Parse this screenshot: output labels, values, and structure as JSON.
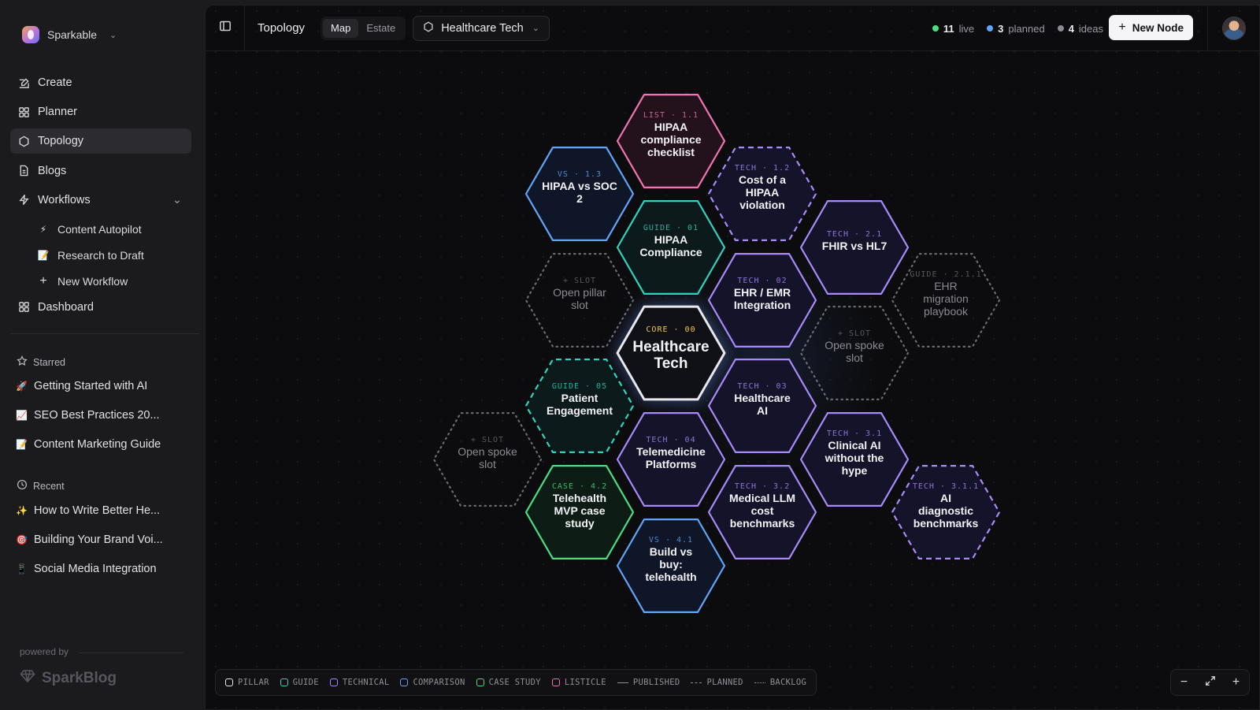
{
  "workspace": {
    "name": "Sparkable"
  },
  "nav": [
    {
      "label": "Create",
      "icon": "edit-icon"
    },
    {
      "label": "Planner",
      "icon": "grid-icon"
    },
    {
      "label": "Topology",
      "icon": "hexagon-icon",
      "active": true
    },
    {
      "label": "Blogs",
      "icon": "document-icon"
    },
    {
      "label": "Workflows",
      "icon": "lightning-icon"
    }
  ],
  "workflows": [
    {
      "label": "Content Autopilot",
      "icon": "⚡"
    },
    {
      "label": "Research to Draft",
      "icon": "📝"
    },
    {
      "label": "New Workflow",
      "icon": "+"
    }
  ],
  "dashboard": {
    "label": "Dashboard"
  },
  "starred": {
    "title": "Starred",
    "items": [
      {
        "label": "Getting Started with AI",
        "icon": "🚀"
      },
      {
        "label": "SEO Best Practices 20...",
        "icon": "📈"
      },
      {
        "label": "Content Marketing Guide",
        "icon": "📝"
      }
    ]
  },
  "recent": {
    "title": "Recent",
    "items": [
      {
        "label": "How to Write Better He...",
        "icon": "✨"
      },
      {
        "label": "Building Your Brand Voi...",
        "icon": "🎯"
      },
      {
        "label": "Social Media Integration",
        "icon": "📱"
      }
    ]
  },
  "footer": {
    "powered": "powered by",
    "brand": "SparkBlog"
  },
  "topbar": {
    "title": "Topology",
    "views": [
      "Map",
      "Estate"
    ],
    "active_view": "Map",
    "project": "Healthcare Tech"
  },
  "stats": [
    {
      "count": "11",
      "label": "live",
      "color": "#4ade80"
    },
    {
      "count": "3",
      "label": "planned",
      "color": "#60a5fa"
    },
    {
      "count": "4",
      "label": "ideas",
      "color": "#8a8a92"
    }
  ],
  "new_node_label": "New Node",
  "colors": {
    "pillar": "#e8e8ec",
    "guide": "#2dd4bf",
    "technical": "#a78bfa",
    "comparison": "#60a5fa",
    "case": "#4ade80",
    "listicle": "#f472b6",
    "slot": "#6a6a72"
  },
  "nodes": [
    {
      "tag": "LIST · 1.1",
      "title": [
        "HIPAA",
        "compliance",
        "checklist"
      ],
      "kind": "listicle",
      "status": "published"
    },
    {
      "tag": "VS · 1.3",
      "title": [
        "HIPAA vs SOC",
        "2"
      ],
      "kind": "comparison",
      "status": "published"
    },
    {
      "tag": "TECH · 1.2",
      "title": [
        "Cost of a",
        "HIPAA",
        "violation"
      ],
      "kind": "technical",
      "status": "planned"
    },
    {
      "tag": "GUIDE · 01",
      "title": [
        "HIPAA",
        "Compliance"
      ],
      "kind": "guide",
      "status": "published"
    },
    {
      "tag": "TECH · 2.1",
      "title": [
        "FHIR vs HL7"
      ],
      "kind": "technical",
      "status": "published"
    },
    {
      "tag": "+ SLOT",
      "title": [
        "Open pillar",
        "slot"
      ],
      "kind": "slot",
      "status": "backlog"
    },
    {
      "tag": "TECH · 02",
      "title": [
        "EHR / EMR",
        "Integration"
      ],
      "kind": "technical",
      "status": "published"
    },
    {
      "tag": "GUIDE · 2.1.1",
      "title": [
        "EHR",
        "migration",
        "playbook"
      ],
      "kind": "slot",
      "status": "backlog"
    },
    {
      "tag": "CORE · 00",
      "title": [
        "Healthcare",
        "Tech"
      ],
      "kind": "pillar",
      "status": "published"
    },
    {
      "tag": "+ SLOT",
      "title": [
        "Open spoke",
        "slot"
      ],
      "kind": "slot",
      "status": "backlog"
    },
    {
      "tag": "GUIDE · 05",
      "title": [
        "Patient",
        "Engagement"
      ],
      "kind": "guide",
      "status": "planned"
    },
    {
      "tag": "TECH · 03",
      "title": [
        "Healthcare",
        "AI"
      ],
      "kind": "technical",
      "status": "published"
    },
    {
      "tag": "+ SLOT",
      "title": [
        "Open spoke",
        "slot"
      ],
      "kind": "slot",
      "status": "backlog"
    },
    {
      "tag": "TECH · 04",
      "title": [
        "Telemedicine",
        "Platforms"
      ],
      "kind": "technical",
      "status": "published"
    },
    {
      "tag": "TECH · 3.1",
      "title": [
        "Clinical AI",
        "without the",
        "hype"
      ],
      "kind": "technical",
      "status": "published"
    },
    {
      "tag": "CASE · 4.2",
      "title": [
        "Telehealth",
        "MVP case",
        "study"
      ],
      "kind": "case",
      "status": "published"
    },
    {
      "tag": "TECH · 3.2",
      "title": [
        "Medical LLM",
        "cost",
        "benchmarks"
      ],
      "kind": "technical",
      "status": "published"
    },
    {
      "tag": "TECH · 3.1.1",
      "title": [
        "AI",
        "diagnostic",
        "benchmarks"
      ],
      "kind": "technical",
      "status": "planned"
    },
    {
      "tag": "VS · 4.1",
      "title": [
        "Build vs",
        "buy:",
        "telehealth"
      ],
      "kind": "comparison",
      "status": "published"
    }
  ],
  "legend": {
    "kinds": [
      {
        "label": "PILLAR",
        "color": "#e8e8ec"
      },
      {
        "label": "GUIDE",
        "color": "#2dd4bf"
      },
      {
        "label": "TECHNICAL",
        "color": "#a78bfa"
      },
      {
        "label": "COMPARISON",
        "color": "#60a5fa"
      },
      {
        "label": "CASE STUDY",
        "color": "#4ade80"
      },
      {
        "label": "LISTICLE",
        "color": "#f472b6"
      }
    ],
    "styles": [
      {
        "label": "PUBLISHED",
        "style": "solid"
      },
      {
        "label": "PLANNED",
        "style": "dashed"
      },
      {
        "label": "BACKLOG",
        "style": "dotted"
      }
    ]
  }
}
